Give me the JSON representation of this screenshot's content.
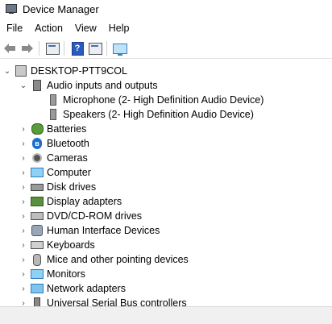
{
  "window": {
    "title": "Device Manager"
  },
  "menu": [
    "File",
    "Action",
    "View",
    "Help"
  ],
  "toolbar": {
    "help_glyph": "?"
  },
  "tree": {
    "root": "DESKTOP-PTT9COL",
    "audio": {
      "label": "Audio inputs and outputs",
      "children": [
        "Microphone (2- High Definition Audio Device)",
        "Speakers (2- High Definition Audio Device)"
      ]
    },
    "categories": [
      "Batteries",
      "Bluetooth",
      "Cameras",
      "Computer",
      "Disk drives",
      "Display adapters",
      "DVD/CD-ROM drives",
      "Human Interface Devices",
      "Keyboards",
      "Mice and other pointing devices",
      "Monitors",
      "Network adapters",
      "Universal Serial Bus controllers"
    ]
  },
  "icons": {
    "bluetooth_glyph": "ʙ",
    "chevron_expanded": "⌄",
    "chevron_collapsed": "›"
  }
}
